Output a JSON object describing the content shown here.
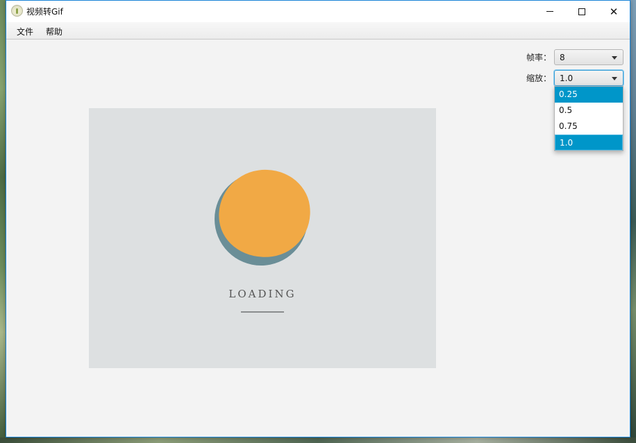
{
  "window": {
    "title": "视频转Gif"
  },
  "menubar": {
    "items": [
      {
        "label": "文件"
      },
      {
        "label": "帮助"
      }
    ]
  },
  "controls": {
    "fps": {
      "label": "帧率：",
      "value": "8"
    },
    "scale": {
      "label": "缩放：",
      "value": "1.0",
      "options": [
        "0.25",
        "0.5",
        "0.75",
        "1.0"
      ],
      "highlighted": "0.25",
      "selected": "1.0"
    }
  },
  "preview": {
    "loading_text": "LOADING"
  },
  "colors": {
    "accent": "#0096c9",
    "focus_border": "#3a9fd6",
    "preview_bg": "#dde0e1",
    "sun": "#f1a945",
    "shadow": "#6a8e97"
  }
}
